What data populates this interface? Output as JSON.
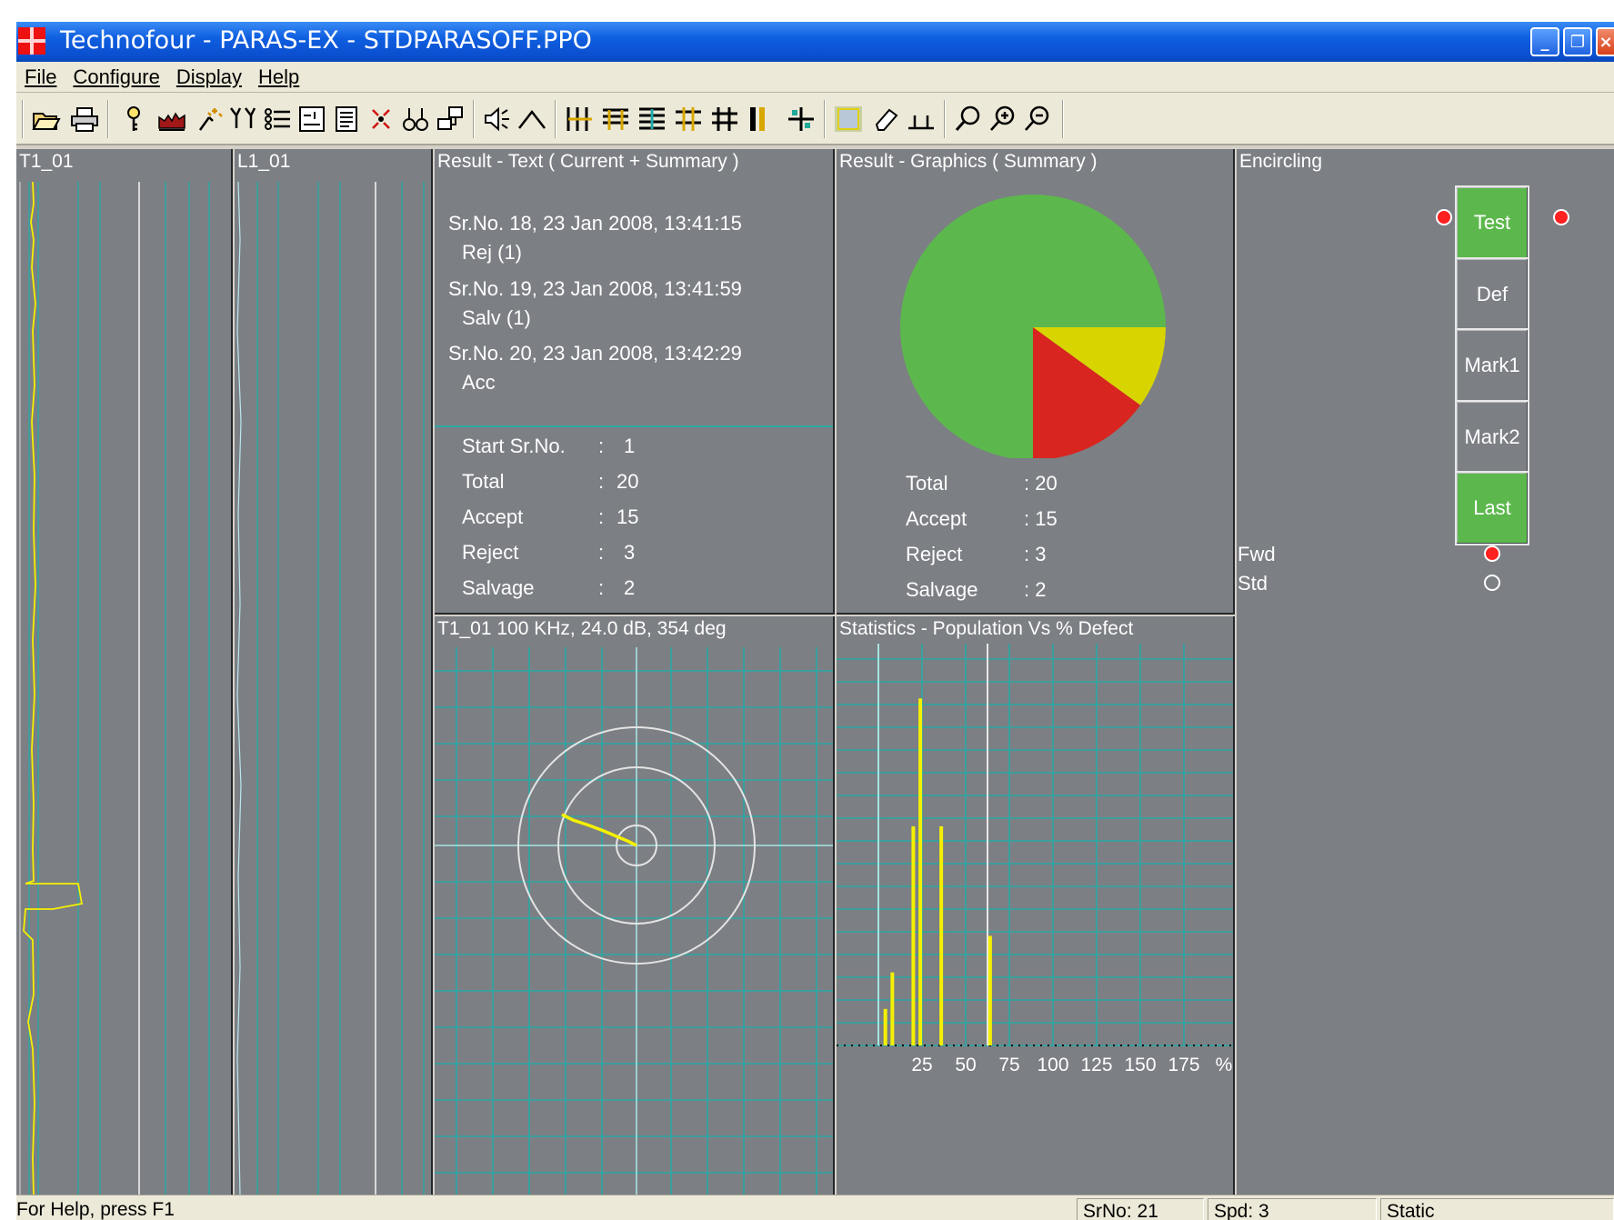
{
  "window": {
    "title": "Technofour - PARAS-EX - STDPARASOFF.PPO",
    "controls": [
      "_",
      "❐",
      "×"
    ]
  },
  "menu": [
    {
      "label": "File"
    },
    {
      "label": "Configure"
    },
    {
      "label": "Display"
    },
    {
      "label": "Help"
    }
  ],
  "toolbar": {
    "buttons": [
      "open-icon",
      "print-icon",
      "probe-icon",
      "chart-icon",
      "calibrate-icon",
      "filter-icon",
      "list-icon",
      "channel-icon",
      "report-icon",
      "spark-icon",
      "cluster-icon",
      "network-icon",
      "sound-icon",
      "peak-icon",
      "vgrid-icon",
      "hgrid-icon",
      "hgrid2-icon",
      "cross-grid-icon",
      "grid-icon",
      "bar-icon",
      "split-icon",
      "highlight-icon",
      "erase-icon",
      "baseline-icon",
      "zoom-icon",
      "zoom-in-icon",
      "zoom-out-icon"
    ]
  },
  "panels": {
    "strip1_title": "T1_01",
    "strip2_title": "L1_01",
    "result_text_title": "Result - Text ( Current + Summary )",
    "result_graphics_title": "Result - Graphics ( Summary )",
    "impedance_title": "T1_01 100 KHz, 24.0 dB, 354 deg",
    "statistics_title": "Statistics - Population Vs % Defect",
    "encircling_title": "Encircling"
  },
  "results_current": [
    {
      "line1": "Sr.No. 18,  23 Jan 2008, 13:41:15",
      "line2": "Rej (1)"
    },
    {
      "line1": "Sr.No. 19,  23 Jan 2008, 13:41:59",
      "line2": "Salv (1)"
    },
    {
      "line1": "Sr.No. 20,  23 Jan 2008, 13:42:29",
      "line2": "Acc"
    }
  ],
  "summary_text": [
    {
      "label": "Start Sr.No.",
      "sep": ":",
      "value": "1"
    },
    {
      "label": "Total",
      "sep": ":",
      "value": "20"
    },
    {
      "label": "Accept",
      "sep": ":",
      "value": "15"
    },
    {
      "label": "Reject",
      "sep": ":",
      "value": "3"
    },
    {
      "label": "Salvage",
      "sep": ":",
      "value": "2"
    }
  ],
  "summary_graphics": [
    {
      "label": "Total",
      "value": ": 20"
    },
    {
      "label": "Accept",
      "value": ": 15"
    },
    {
      "label": "Reject",
      "value": ": 3"
    },
    {
      "label": "Salvage",
      "value": ": 2"
    }
  ],
  "colors": {
    "accept": "#5cb84c",
    "reject": "#d8251f",
    "salvage": "#d8d400",
    "panel_bg": "#7c7f84",
    "trace": "#f4f000",
    "grid": "#29a9a4"
  },
  "chart_data": [
    {
      "type": "pie",
      "categories": [
        "Accept",
        "Reject",
        "Salvage"
      ],
      "values": [
        15,
        3,
        2
      ]
    },
    {
      "type": "bar",
      "title": "Statistics - Population Vs % Defect",
      "xlabel": "%",
      "xticks": [
        "25",
        "50",
        "75",
        "100",
        "125",
        "150",
        "175"
      ],
      "xlim": [
        0,
        185
      ],
      "x": [
        4,
        8,
        20,
        24,
        36,
        64
      ],
      "values": [
        2,
        4,
        12,
        19,
        12,
        6
      ],
      "ylim": [
        0,
        22
      ]
    }
  ],
  "encircling": {
    "buttons": [
      "Test",
      "Def",
      "Mark1",
      "Mark2",
      "Last"
    ],
    "fwd_label": "Fwd",
    "std_label": "Std"
  },
  "status": {
    "help": "For Help, press F1",
    "srno": "SrNo: 21",
    "spd": "Spd: 3",
    "mode": "Static"
  }
}
